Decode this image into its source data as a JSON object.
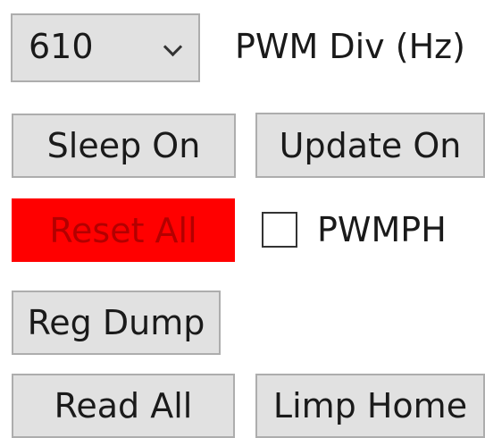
{
  "pwm_select": {
    "value": "610"
  },
  "pwm_div_label": "PWM Div (Hz)",
  "buttons": {
    "sleep_on": "Sleep On",
    "update_on": "Update On",
    "reset_all": "Reset All",
    "reg_dump": "Reg Dump",
    "read_all": "Read All",
    "limp_home": "Limp Home"
  },
  "pwmph_checkbox": {
    "label": "PWMPH",
    "checked": false
  },
  "colors": {
    "reset_bg": "#ff0000",
    "button_bg": "#e1e1e1"
  }
}
